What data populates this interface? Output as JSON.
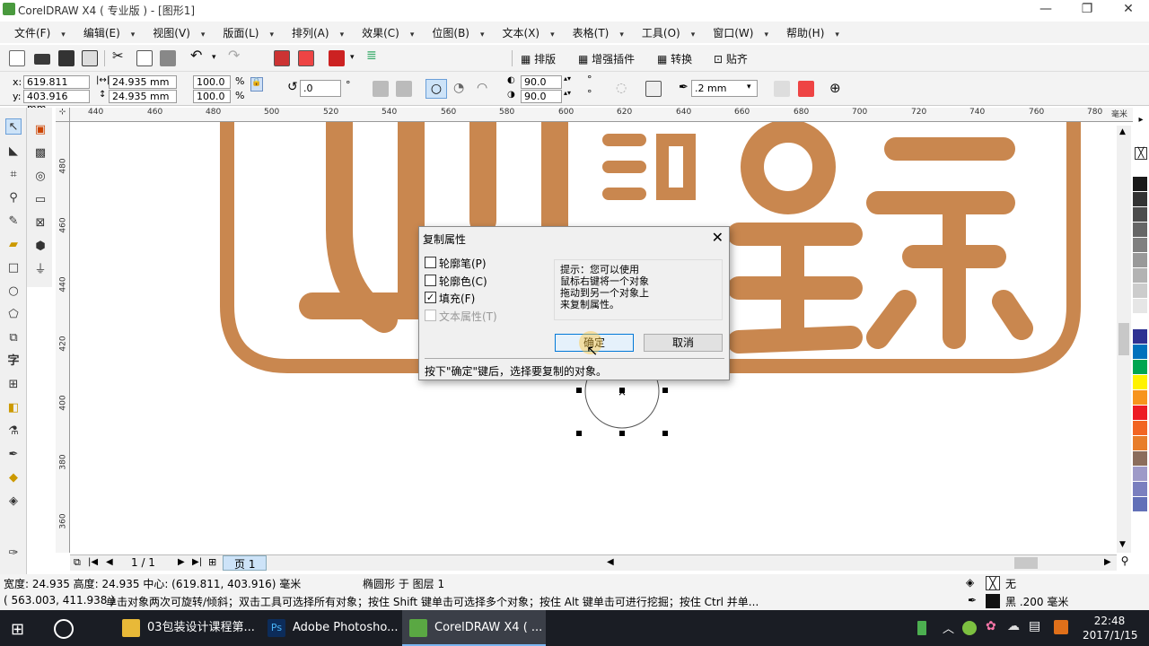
{
  "title": "CorelDRAW X4 ( 专业版 ) - [图形1]",
  "window_controls": {
    "minimize": "—",
    "restore": "❐",
    "close": "✕"
  },
  "menu": [
    "文件(F)",
    "编辑(E)",
    "视图(V)",
    "版面(L)",
    "排列(A)",
    "效果(C)",
    "位图(B)",
    "文本(X)",
    "表格(T)",
    "工具(O)",
    "窗口(W)",
    "帮助(H)"
  ],
  "toolbar1": {
    "plugins": [
      "排版",
      "增强插件",
      "转换",
      "贴齐"
    ]
  },
  "property_bar": {
    "x_label": "x:",
    "x_value": "619.811 mm",
    "y_label": "y:",
    "y_value": "403.916 mm",
    "w_value": "24.935 mm",
    "h_value": "24.935 mm",
    "scale_x": "100.0",
    "scale_y": "100.0",
    "percent": "%",
    "rotation": ".0",
    "degree": "°",
    "start_angle": "90.0",
    "end_angle": "90.0",
    "outline_width": ".2 mm"
  },
  "hruler_ticks": [
    "440",
    "460",
    "480",
    "500",
    "520",
    "540",
    "560",
    "580",
    "600",
    "620",
    "640",
    "660",
    "680",
    "700",
    "720",
    "740",
    "760",
    "780"
  ],
  "hruler_unit": "毫米",
  "vruler_ticks": [
    "480",
    "460",
    "440",
    "420",
    "400",
    "380",
    "360"
  ],
  "page_nav": {
    "page_count": "1 / 1",
    "page_tab": "页 1"
  },
  "status": {
    "dimensions": "宽度: 24.935 高度: 24.935 中心: (619.811, 403.916)  毫米",
    "object_info": "椭圆形 于 图层 1",
    "fill_label": "无",
    "coords": "( 563.003, 411.938 )",
    "hint": "单击对象两次可旋转/倾斜；双击工具可选择所有对象；按住 Shift 键单击可选择多个对象；按住 Alt 键单击可进行挖掘；按住 Ctrl 并单...",
    "outline_label": "黑  .200 毫米"
  },
  "dialog": {
    "title": "复制属性",
    "options": [
      {
        "label": "轮廓笔(P)",
        "checked": false,
        "enabled": true
      },
      {
        "label": "轮廓色(C)",
        "checked": false,
        "enabled": true
      },
      {
        "label": "填充(F)",
        "checked": true,
        "enabled": true
      },
      {
        "label": "文本属性(T)",
        "checked": false,
        "enabled": false
      }
    ],
    "tip_lines": [
      "提示：您可以使用",
      "鼠标右键将一个对象",
      "拖动到另一个对象上",
      "来复制属性。"
    ],
    "ok": "确定",
    "cancel": "取消",
    "footer": "按下\"确定\"键后，选择要复制的对象。"
  },
  "taskbar": {
    "items": [
      "03包装设计课程第...",
      "Adobe Photosho...",
      "CorelDRAW X4 ( ..."
    ],
    "time": "22:48",
    "date": "2017/1/15"
  },
  "colors": {
    "artwork": "#c9874f",
    "accent": "#0078d7"
  },
  "palette": [
    "#ffffff",
    "#1a1a1a",
    "#333333",
    "#4d4d4d",
    "#666666",
    "#808080",
    "#999999",
    "#b3b3b3",
    "#cccccc",
    "#e6e6e6",
    "#ffffff",
    "#2e3192",
    "#0071bc",
    "#00a651",
    "#fff200",
    "#f7941d",
    "#ed1c24",
    "#f26522",
    "#e87d2a",
    "#8b6d5c",
    "#9e9ac8",
    "#7a7fbf",
    "#6270b8"
  ]
}
